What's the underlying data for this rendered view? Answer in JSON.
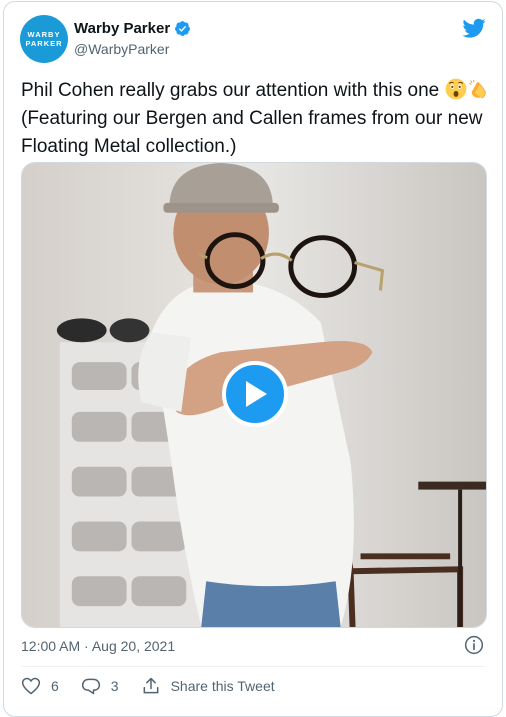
{
  "author": {
    "avatar_line1": "WARBY",
    "avatar_line2": "PARKER",
    "display_name": "Warby Parker",
    "handle": "@WarbyParker",
    "verified": true
  },
  "tweet": {
    "text_before_emoji": "Phil Cohen really grabs our attention with this one ",
    "emojis": [
      "astonished-face",
      "clapping-hands"
    ],
    "text_after_emoji": " (Featuring our Bergen and Callen frames from our new Floating Metal collection.)"
  },
  "media": {
    "type": "video",
    "play_icon": "play-icon"
  },
  "meta": {
    "timestamp": "12:00 AM · Aug 20, 2021"
  },
  "actions": {
    "like_count": "6",
    "reply_count": "3",
    "share_label": "Share this Tweet"
  },
  "colors": {
    "accent": "#1d9bf0",
    "avatar_bg": "#1a9bd8",
    "secondary_text": "#536471",
    "border": "#cfd9de"
  }
}
